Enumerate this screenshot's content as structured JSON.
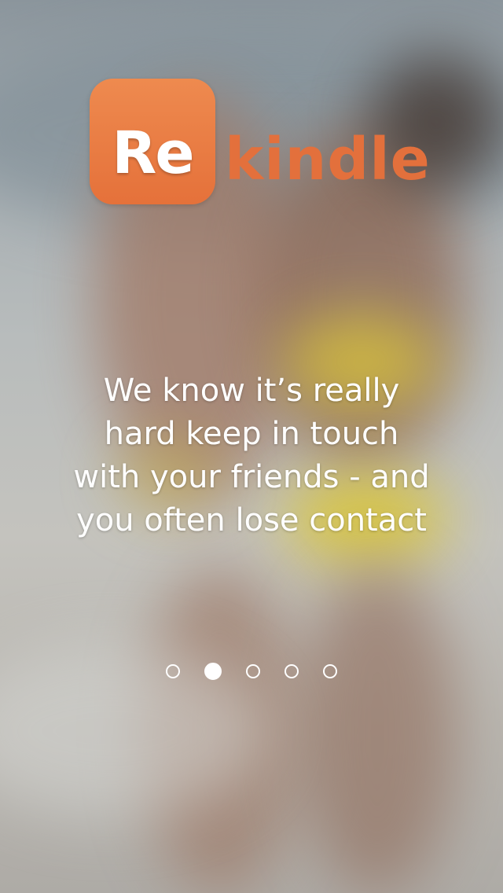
{
  "logo": {
    "badge_text": "Re",
    "word": "kindle",
    "brand_color": "#e3703c"
  },
  "tagline": {
    "lines": [
      "We know it’s really",
      "hard keep in touch",
      "with your friends - and",
      "you often lose contact"
    ]
  },
  "pager": {
    "total": 5,
    "active_index": 1
  }
}
